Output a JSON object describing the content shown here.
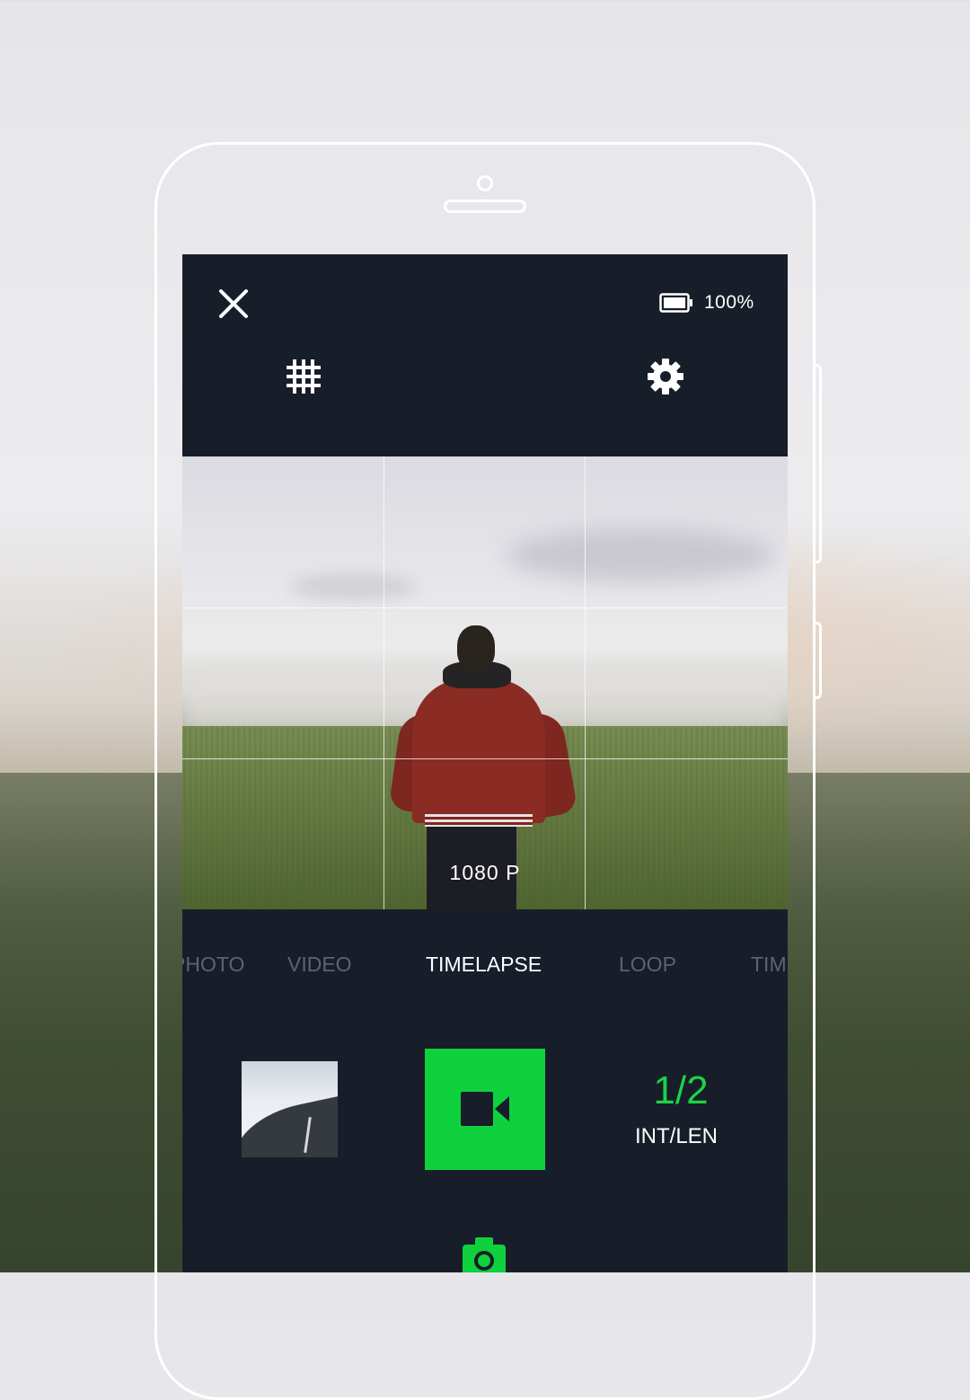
{
  "status": {
    "battery_label": "100%"
  },
  "icons": {
    "close": "close-icon",
    "battery": "battery-icon",
    "grid": "grid-icon",
    "settings": "gear-icon",
    "record": "video-camera-icon",
    "photo": "camera-icon"
  },
  "viewfinder": {
    "resolution_label": "1080 P"
  },
  "modes": [
    {
      "label": "PHOTO",
      "active": false
    },
    {
      "label": "VIDEO",
      "active": false
    },
    {
      "label": "TIMELAPSE",
      "active": true
    },
    {
      "label": "LOOP",
      "active": false
    },
    {
      "label": "TIME",
      "active": false
    }
  ],
  "controls": {
    "interval_value": "1/2",
    "interval_label": "INT/LEN"
  },
  "colors": {
    "accent": "#0fd13d",
    "screen_bg": "#171e29",
    "inactive_mode": "#5d6470"
  }
}
